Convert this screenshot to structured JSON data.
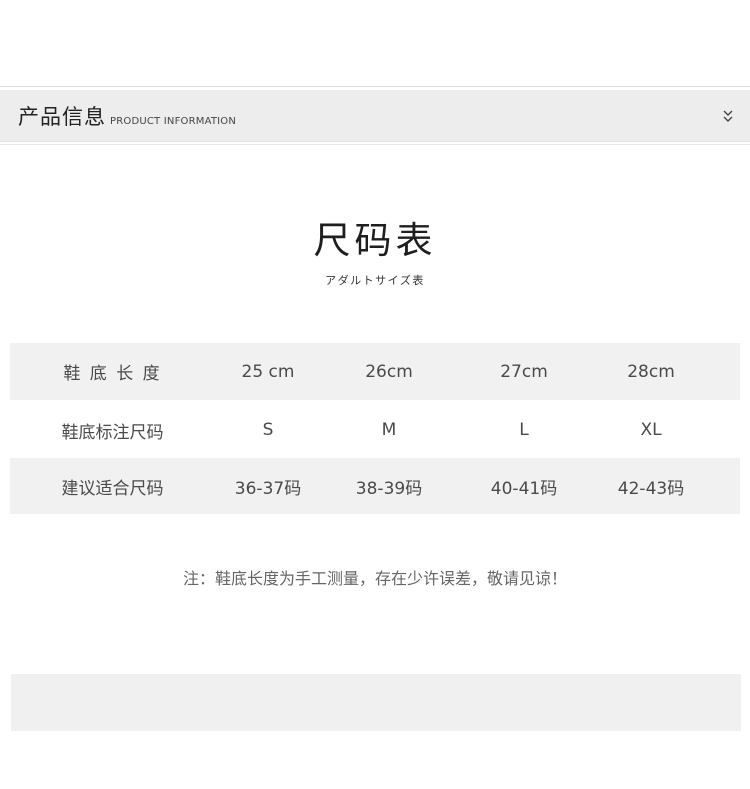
{
  "header": {
    "title_cn": "产品信息",
    "title_en": "PRODUCT INFORMATION",
    "toggle_icon": "double-chevron-down-icon"
  },
  "size_chart": {
    "title": "尺码表",
    "subtitle": "アダルトサイズ表"
  },
  "table": {
    "rows": [
      {
        "label": "鞋 底 长 度",
        "values": [
          "25 cm",
          "26cm",
          "27cm",
          "28cm"
        ]
      },
      {
        "label": "鞋底标注尺码",
        "values": [
          "S",
          "M",
          "L",
          "XL"
        ]
      },
      {
        "label": "建议适合尺码",
        "values": [
          "36-37码",
          "38-39码",
          "40-41码",
          "42-43码"
        ]
      }
    ]
  },
  "note": "注：鞋底长度为手工测量，存在少许误差，敬请见谅！",
  "colors": {
    "header_bg": "#ededed",
    "row_shade": "#f1f1f1",
    "text": "#4a4a4a"
  }
}
